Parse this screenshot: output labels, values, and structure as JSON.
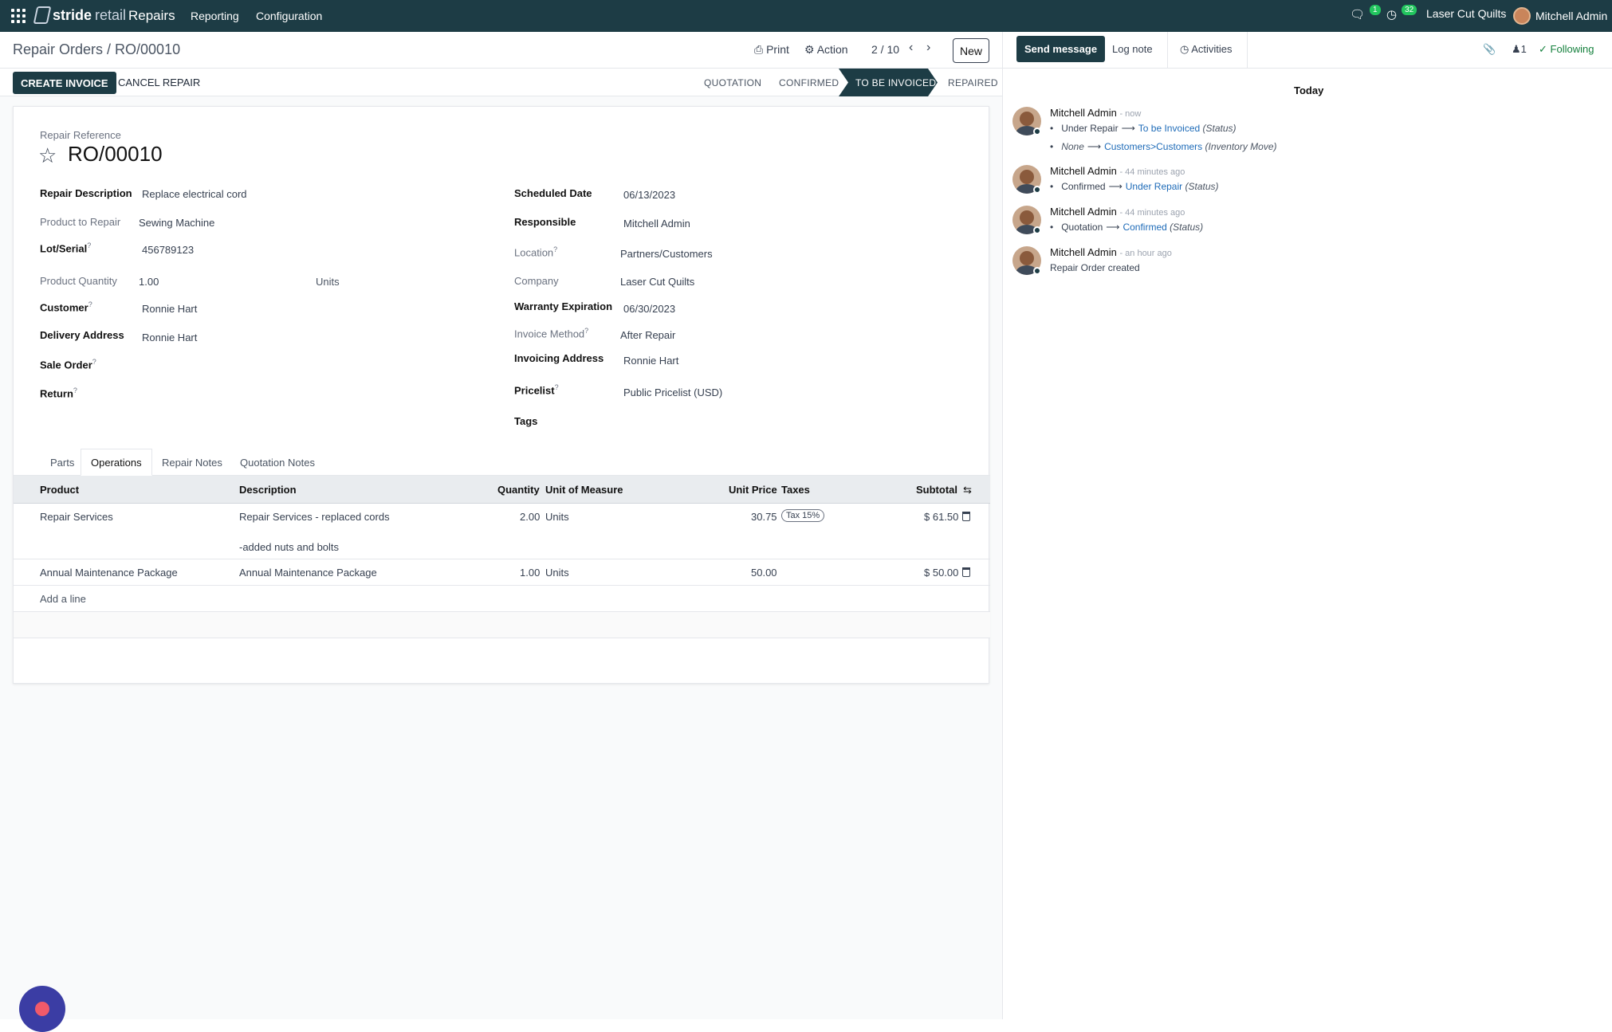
{
  "topbar": {
    "brand_bold": "stride",
    "brand_light": "retail",
    "app": "Repairs",
    "menu": [
      "Reporting",
      "Configuration"
    ],
    "messages_count": "1",
    "activities_count": "32",
    "company": "Laser Cut Quilts",
    "user": "Mitchell Admin"
  },
  "breadcrumb": "Repair Orders / RO/00010",
  "controls": {
    "print": "Print",
    "action": "Action",
    "pager": "2 / 10",
    "new": "New"
  },
  "status": {
    "create_invoice": "CREATE INVOICE",
    "cancel_repair": "CANCEL REPAIR",
    "stages": [
      "QUOTATION",
      "CONFIRMED",
      "TO BE INVOICED",
      "REPAIRED"
    ],
    "active_stage": "TO BE INVOICED"
  },
  "form": {
    "ref_label": "Repair Reference",
    "ref": "RO/00010",
    "left": {
      "repair_description_label": "Repair Description",
      "repair_description": "Replace electrical cord",
      "product_label": "Product to Repair",
      "product": "Sewing Machine",
      "lot_label": "Lot/Serial",
      "lot": "456789123",
      "qty_label": "Product Quantity",
      "qty": "1.00",
      "qty_uom": "Units",
      "customer_label": "Customer",
      "customer": "Ronnie Hart",
      "delivery_label": "Delivery Address",
      "delivery": "Ronnie Hart",
      "sale_order_label": "Sale Order",
      "return_label": "Return"
    },
    "right": {
      "scheduled_label": "Scheduled Date",
      "scheduled": "06/13/2023",
      "responsible_label": "Responsible",
      "responsible": "Mitchell Admin",
      "location_label": "Location",
      "location": "Partners/Customers",
      "company_label": "Company",
      "company": "Laser Cut Quilts",
      "warranty_label": "Warranty Expiration",
      "warranty": "06/30/2023",
      "invoice_method_label": "Invoice Method",
      "invoice_method": "After Repair",
      "invoicing_address_label": "Invoicing Address",
      "invoicing_address": "Ronnie Hart",
      "pricelist_label": "Pricelist",
      "pricelist": "Public Pricelist (USD)",
      "tags_label": "Tags"
    }
  },
  "tabs": [
    "Parts",
    "Operations",
    "Repair Notes",
    "Quotation Notes"
  ],
  "table": {
    "headers": [
      "Product",
      "Description",
      "Quantity",
      "Unit of Measure",
      "Unit Price",
      "Taxes",
      "Subtotal"
    ],
    "rows": [
      {
        "product": "Repair Services",
        "description": "Repair Services - replaced cords",
        "description2": "-added nuts and bolts",
        "quantity": "2.00",
        "uom": "Units",
        "unit_price": "30.75",
        "taxes": "Tax 15%",
        "subtotal": "$ 61.50"
      },
      {
        "product": "Annual Maintenance Package",
        "description": "Annual Maintenance Package",
        "quantity": "1.00",
        "uom": "Units",
        "unit_price": "50.00",
        "taxes": "",
        "subtotal": "$ 50.00"
      }
    ],
    "add_line": "Add a line"
  },
  "chatter": {
    "send_message": "Send message",
    "log_note": "Log note",
    "activities": "Activities",
    "followers_count": "1",
    "following": "Following",
    "today": "Today",
    "messages": [
      {
        "author": "Mitchell Admin",
        "time": "- now",
        "lines": [
          {
            "from": "Under Repair",
            "to": "To be Invoiced",
            "field": "(Status)"
          },
          {
            "from": "None",
            "to": "Customers>Customers",
            "field": "(Inventory Move)"
          }
        ]
      },
      {
        "author": "Mitchell Admin",
        "time": "- 44 minutes ago",
        "lines": [
          {
            "from": "Confirmed",
            "to": "Under Repair",
            "field": "(Status)"
          }
        ]
      },
      {
        "author": "Mitchell Admin",
        "time": "- 44 minutes ago",
        "lines": [
          {
            "from": "Quotation",
            "to": "Confirmed",
            "field": "(Status)"
          }
        ]
      },
      {
        "author": "Mitchell Admin",
        "time": "- an hour ago",
        "text": "Repair Order created"
      }
    ]
  },
  "colors": {
    "primary": "#1d3c45",
    "link": "#1e6bb8",
    "success": "#22c55e",
    "fab": "#3b3da4"
  }
}
